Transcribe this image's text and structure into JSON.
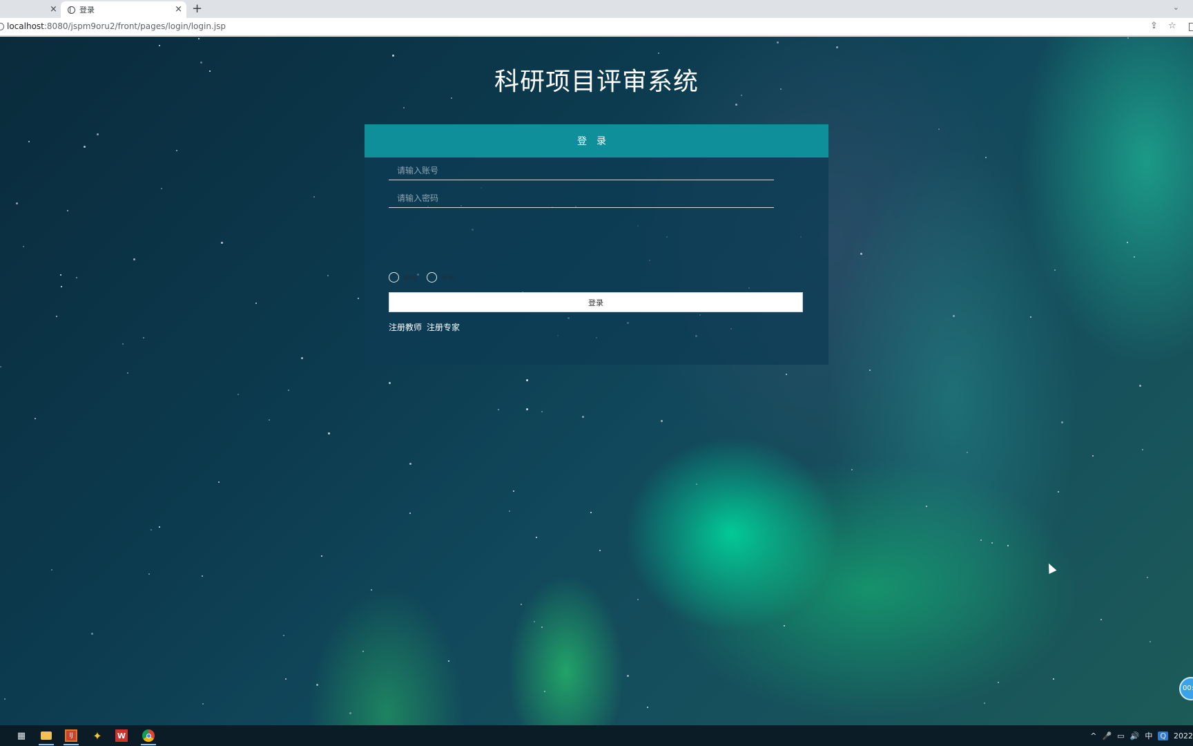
{
  "browser": {
    "tabs": [
      {
        "label": "",
        "close": "×"
      },
      {
        "label": "登录",
        "close": "×"
      }
    ],
    "new_tab": "+",
    "tab_menu": "⌄",
    "url_host": "localhost",
    "url_path": ":8080/jspm9oru2/front/pages/login/login.jsp",
    "share_icon": "⇪",
    "bookmark_icon": "☆"
  },
  "page": {
    "system_title": "科研项目评审系统",
    "login_header": "登录",
    "account": {
      "placeholder": "请输入账号",
      "value": ""
    },
    "password": {
      "placeholder": "请输入密码",
      "value": ""
    },
    "roles": [
      {
        "label": "教师",
        "selected": false
      },
      {
        "label": "专家",
        "selected": false
      }
    ],
    "login_button": "登录",
    "links": [
      "注册教师",
      "注册专家"
    ],
    "float_ball": "00:"
  },
  "taskbar": {
    "task_view_icon": "▦",
    "idea_label": "IJ",
    "wps_label": "W",
    "app_icon": "✦",
    "tray_caret": "^",
    "mic_icon": "🎤",
    "network_icon": "▭",
    "volume_icon": "🔊",
    "ime_label": "中",
    "q_label": "Q",
    "clock": "2022"
  },
  "colors": {
    "header_teal": "#0f8f99",
    "panel": "#0c3c55",
    "button_bg": "#ffffff"
  }
}
